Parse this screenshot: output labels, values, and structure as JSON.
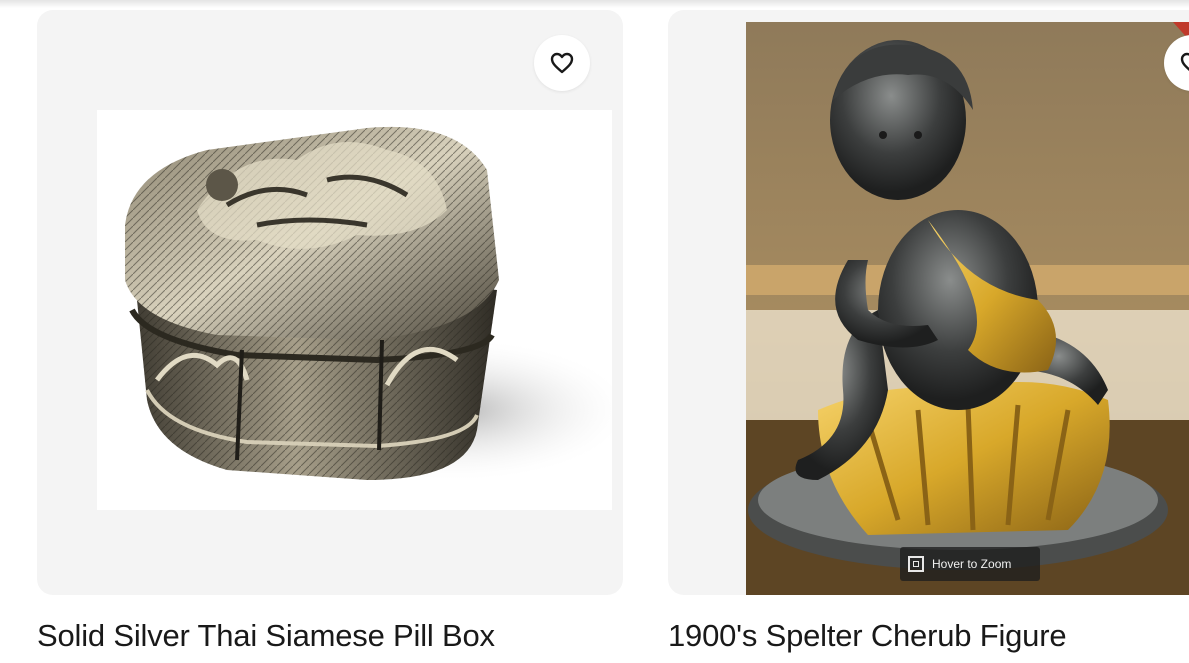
{
  "listings": [
    {
      "title": "Solid Silver Thai Siamese Pill Box",
      "favorite_icon": "heart-outline-icon"
    },
    {
      "title": "1900's Spelter Cherub Figure",
      "favorite_icon": "heart-outline-icon",
      "zoom_hint": "Hover to Zoom"
    }
  ],
  "colors": {
    "card_background": "#f4f4f4",
    "title_text": "#191919",
    "gold_accent": "#d8a82a"
  }
}
